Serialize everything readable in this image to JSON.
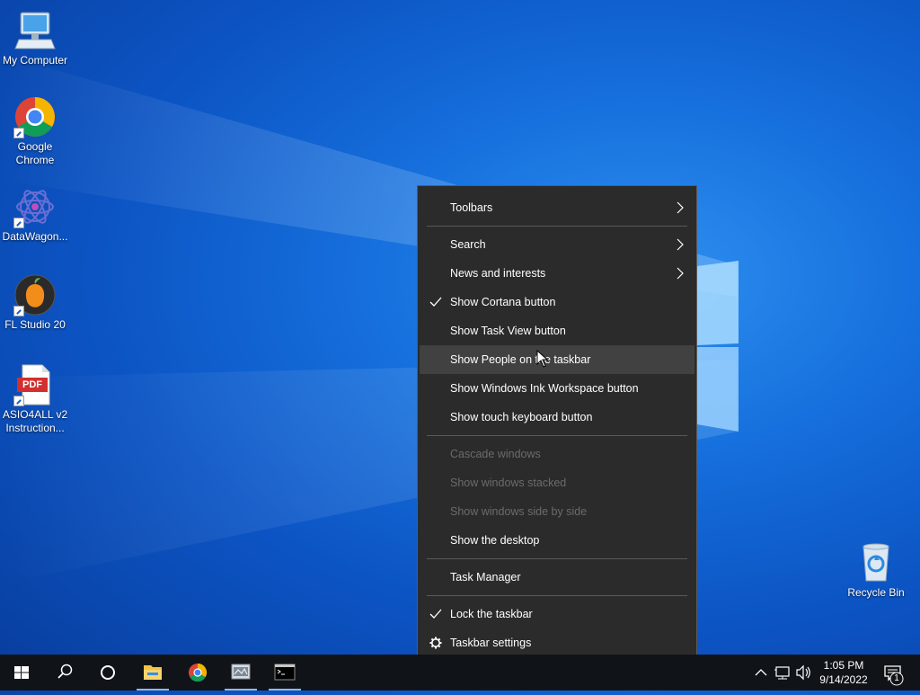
{
  "desktop": {
    "icons": [
      {
        "label": "My Computer"
      },
      {
        "label": "Google Chrome"
      },
      {
        "label": "DataWagon..."
      },
      {
        "label": "FL Studio 20"
      },
      {
        "label": "ASIO4ALL v2 Instruction..."
      },
      {
        "label": "Recycle Bin"
      }
    ],
    "pdf_badge": "PDF"
  },
  "context_menu": {
    "items": [
      {
        "label": "Toolbars"
      },
      {
        "label": "Search"
      },
      {
        "label": "News and interests"
      },
      {
        "label": "Show Cortana button"
      },
      {
        "label": "Show Task View button"
      },
      {
        "label": "Show People on the taskbar"
      },
      {
        "label": "Show Windows Ink Workspace button"
      },
      {
        "label": "Show touch keyboard button"
      },
      {
        "label": "Cascade windows"
      },
      {
        "label": "Show windows stacked"
      },
      {
        "label": "Show windows side by side"
      },
      {
        "label": "Show the desktop"
      },
      {
        "label": "Task Manager"
      },
      {
        "label": "Lock the taskbar"
      },
      {
        "label": "Taskbar settings"
      }
    ]
  },
  "taskbar": {
    "clock": {
      "time": "1:05 PM",
      "date": "9/14/2022"
    },
    "notification_count": "1"
  },
  "colors": {
    "menu_bg": "#2b2b2b",
    "menu_hover": "#414141",
    "taskbar_bg": "#101418",
    "desktop_blue": "#0c54c4"
  }
}
